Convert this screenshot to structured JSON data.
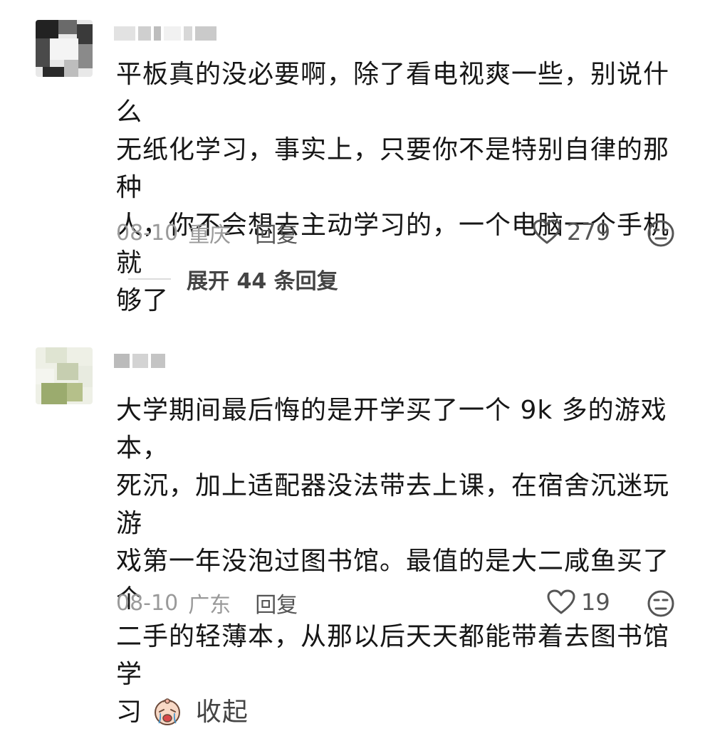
{
  "comments": [
    {
      "text_lines": [
        "平板真的没必要啊，除了看电视爽一些，别说什么",
        "无纸化学习，事实上，只要你不是特别自律的那种",
        "人，你不会想去主动学习的，一个电脑一个手机就",
        "够了"
      ],
      "date": "08-10",
      "location": "重庆",
      "reply_label": "回复",
      "likes": "279",
      "expand_label": "展开 44 条回复"
    },
    {
      "text_lines": [
        "大学期间最后悔的是开学买了一个 9k 多的游戏本，",
        "死沉，加上适配器没法带去上课，在宿舍沉迷玩游",
        "戏第一年没泡过图书馆。最值的是大二咸鱼买了个",
        "二手的轻薄本，从那以后天天都能带着去图书馆学",
        "习"
      ],
      "collapse_label": "收起",
      "date": "08-10",
      "location": "广东",
      "reply_label": "回复",
      "likes": "19"
    }
  ],
  "colors": {
    "text": "#161616",
    "meta": "#9a9a9a",
    "icon": "#555555"
  },
  "icons": [
    "heart-outline-icon",
    "dislike-face-icon",
    "crying-emoji-icon"
  ]
}
